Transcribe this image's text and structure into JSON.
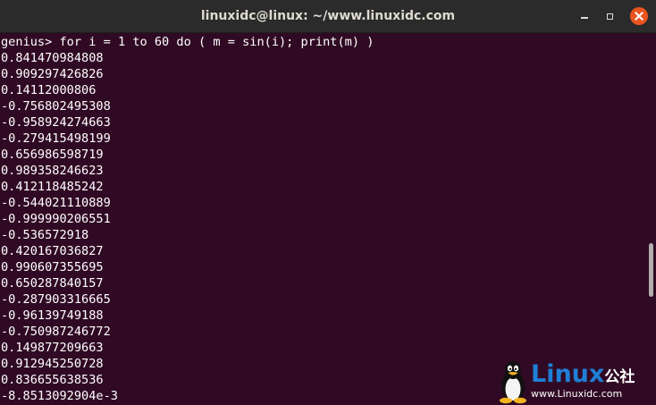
{
  "window": {
    "title": "linuxidc@linux: ~/www.linuxidc.com"
  },
  "terminal": {
    "lines": [
      "genius> for i = 1 to 60 do ( m = sin(i); print(m) )",
      "0.841470984808",
      "0.909297426826",
      "0.14112000806",
      "-0.756802495308",
      "-0.958924274663",
      "-0.279415498199",
      "0.656986598719",
      "0.989358246623",
      "0.412118485242",
      "-0.544021110889",
      "-0.999990206551",
      "-0.536572918",
      "0.420167036827",
      "0.990607355695",
      "0.650287840157",
      "-0.287903316665",
      "-0.96139749188",
      "-0.750987246772",
      "0.149877209663",
      "0.912945250728",
      "0.836655638536",
      "-8.8513092904e-3"
    ]
  },
  "watermark": {
    "brand": "Linux",
    "suffix": "公社",
    "url": "www.Linuxidc.com"
  },
  "colors": {
    "terminal_bg": "#300a24",
    "titlebar_bg": "#2b2b2b",
    "close_button": "#e9541f",
    "watermark_blue": "#1e7fd6"
  },
  "icons": {
    "minimize": "minimize-icon",
    "maximize": "maximize-icon",
    "close": "close-icon",
    "logo": "tux-penguin-icon"
  }
}
